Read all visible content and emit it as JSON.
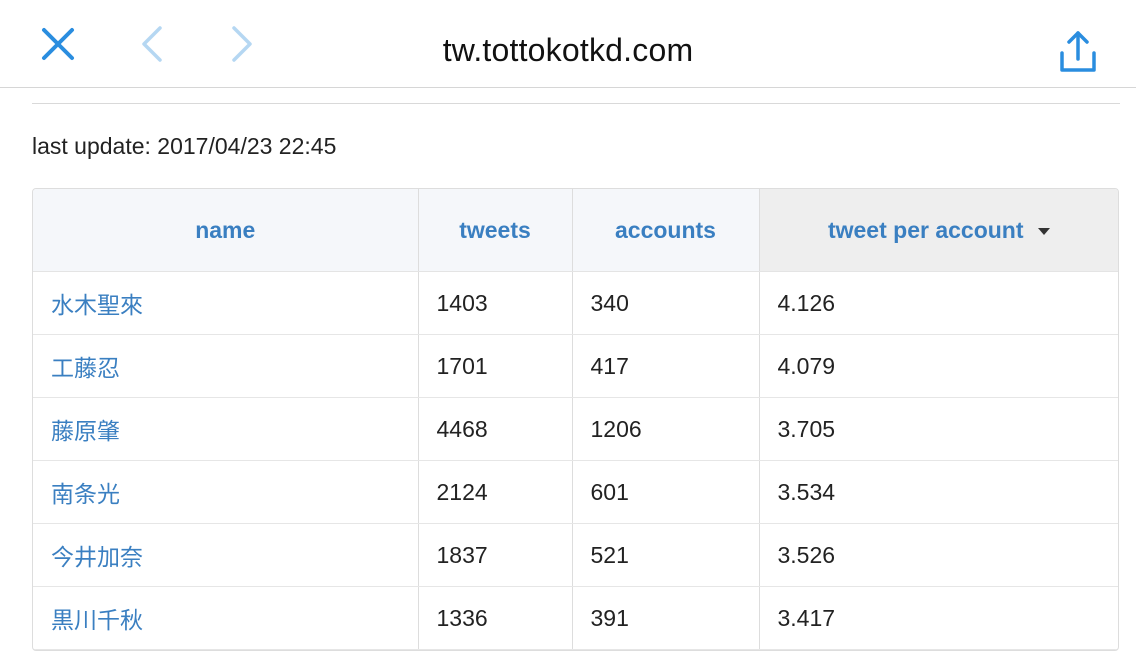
{
  "topbar": {
    "url_title": "tw.tottokotkd.com",
    "close_icon": "close-x-icon",
    "back_icon": "chevron-left-icon",
    "forward_icon": "chevron-right-icon",
    "share_icon": "share-icon",
    "accent_color": "#2a8ddf"
  },
  "last_update": "last update: 2017/04/23 22:45",
  "table": {
    "headers": {
      "name": "name",
      "tweets": "tweets",
      "accounts": "accounts",
      "tweet_per_account": "tweet per account"
    },
    "sorted_by": "tweet per account",
    "sort_direction": "descending",
    "rows": [
      {
        "name": "水木聖來",
        "tweets": "1403",
        "accounts": "340",
        "tpa": "4.126"
      },
      {
        "name": "工藤忍",
        "tweets": "1701",
        "accounts": "417",
        "tpa": "4.079"
      },
      {
        "name": "藤原肇",
        "tweets": "4468",
        "accounts": "1206",
        "tpa": "3.705"
      },
      {
        "name": "南条光",
        "tweets": "2124",
        "accounts": "601",
        "tpa": "3.534"
      },
      {
        "name": "今井加奈",
        "tweets": "1837",
        "accounts": "521",
        "tpa": "3.526"
      },
      {
        "name": "黒川千秋",
        "tweets": "1336",
        "accounts": "391",
        "tpa": "3.417"
      }
    ],
    "link_color": "#3a7fc1"
  }
}
